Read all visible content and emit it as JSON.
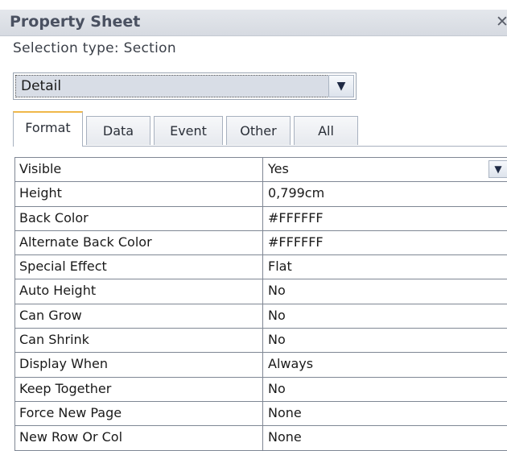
{
  "window": {
    "title": "Property Sheet",
    "close_glyph": "✕"
  },
  "selection": {
    "label": "Selection type:  Section"
  },
  "combo": {
    "value": "Detail",
    "button_icon": "chevron-down-icon",
    "glyph": "▼"
  },
  "tabs": [
    {
      "label": "Format",
      "active": true
    },
    {
      "label": "Data",
      "active": false
    },
    {
      "label": "Event",
      "active": false
    },
    {
      "label": "Other",
      "active": false
    },
    {
      "label": "All",
      "active": false
    }
  ],
  "properties": [
    {
      "name": "Visible",
      "value": "Yes",
      "dropdown": true
    },
    {
      "name": "Height",
      "value": "0,799cm"
    },
    {
      "name": "Back Color",
      "value": "#FFFFFF"
    },
    {
      "name": "Alternate Back Color",
      "value": "#FFFFFF"
    },
    {
      "name": "Special Effect",
      "value": "Flat"
    },
    {
      "name": "Auto Height",
      "value": "No"
    },
    {
      "name": "Can Grow",
      "value": "No"
    },
    {
      "name": "Can Shrink",
      "value": "No"
    },
    {
      "name": "Display When",
      "value": "Always"
    },
    {
      "name": "Keep Together",
      "value": "No"
    },
    {
      "name": "Force New Page",
      "value": "None"
    },
    {
      "name": "New Row Or Col",
      "value": "None"
    }
  ],
  "colors": {
    "active_tab_accent": "#F0B84A",
    "titlebar": "#D6DAE1",
    "combo_field": "#D8DDE6"
  }
}
